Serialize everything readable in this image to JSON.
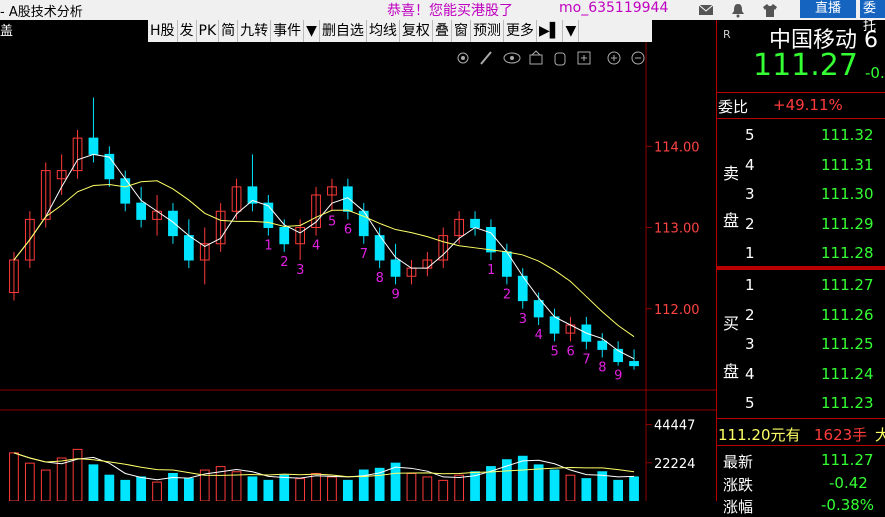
{
  "window": {
    "title": "- A股技术分析",
    "promo": "恭喜！您能买港股了",
    "user": "mo_635119944",
    "live_button": "直播",
    "cut_button": "委托"
  },
  "toolbar": [
    "H股",
    "发",
    "PK",
    "简",
    "九转",
    "事件",
    "▼",
    "删自选",
    "均线",
    "复权",
    "叠",
    "窗",
    "预测",
    "更多",
    "▶▌",
    "▼"
  ],
  "left_stub": "盖",
  "chart": {
    "price_ticks": [
      "114.00",
      "113.00",
      "112.00"
    ],
    "volume_ticks": [
      "44447",
      "22224"
    ],
    "td_labels_a": [
      "1",
      "2",
      "3",
      "4",
      "5",
      "6",
      "7",
      "8",
      "9"
    ],
    "td_labels_b": [
      "1",
      "2",
      "3",
      "4",
      "5",
      "6",
      "7",
      "8",
      "9"
    ],
    "colors": {
      "up": "#ff3b3b",
      "down": "#00e5ff",
      "ma1": "#ffffff",
      "ma2": "#ffff66",
      "td": "#e020e0",
      "grid": "#8b0000"
    }
  },
  "chart_data": {
    "type": "candlestick",
    "ylim": [
      111.0,
      115.0
    ],
    "candles": [
      [
        112.2,
        112.7,
        112.1,
        112.6
      ],
      [
        112.6,
        113.2,
        112.5,
        113.1
      ],
      [
        113.1,
        113.8,
        113.0,
        113.7
      ],
      [
        113.6,
        113.9,
        113.4,
        113.7
      ],
      [
        113.7,
        114.2,
        113.6,
        114.1
      ],
      [
        114.1,
        114.6,
        113.8,
        113.9
      ],
      [
        113.9,
        114.0,
        113.5,
        113.6
      ],
      [
        113.6,
        113.7,
        113.2,
        113.3
      ],
      [
        113.3,
        113.5,
        113.0,
        113.1
      ],
      [
        113.1,
        113.4,
        112.9,
        113.2
      ],
      [
        113.2,
        113.3,
        112.8,
        112.9
      ],
      [
        112.9,
        113.1,
        112.5,
        112.6
      ],
      [
        112.6,
        113.0,
        112.3,
        112.8
      ],
      [
        112.8,
        113.3,
        112.7,
        113.2
      ],
      [
        113.2,
        113.6,
        113.1,
        113.5
      ],
      [
        113.5,
        113.9,
        113.2,
        113.3
      ],
      [
        113.3,
        113.4,
        112.9,
        113.0
      ],
      [
        113.0,
        113.1,
        112.7,
        112.8
      ],
      [
        112.8,
        113.1,
        112.6,
        113.0
      ],
      [
        113.0,
        113.5,
        112.9,
        113.4
      ],
      [
        113.4,
        113.6,
        113.2,
        113.5
      ],
      [
        113.5,
        113.6,
        113.1,
        113.2
      ],
      [
        113.2,
        113.3,
        112.8,
        112.9
      ],
      [
        112.9,
        113.0,
        112.5,
        112.6
      ],
      [
        112.6,
        112.8,
        112.3,
        112.4
      ],
      [
        112.4,
        112.6,
        112.3,
        112.5
      ],
      [
        112.5,
        112.7,
        112.4,
        112.6
      ],
      [
        112.6,
        113.0,
        112.5,
        112.9
      ],
      [
        112.9,
        113.2,
        112.8,
        113.1
      ],
      [
        113.1,
        113.2,
        112.9,
        113.0
      ],
      [
        113.0,
        113.1,
        112.6,
        112.7
      ],
      [
        112.7,
        112.8,
        112.3,
        112.4
      ],
      [
        112.4,
        112.5,
        112.0,
        112.1
      ],
      [
        112.1,
        112.2,
        111.8,
        111.9
      ],
      [
        111.9,
        112.0,
        111.6,
        111.7
      ],
      [
        111.7,
        111.9,
        111.6,
        111.8
      ],
      [
        111.8,
        111.9,
        111.5,
        111.6
      ],
      [
        111.6,
        111.7,
        111.4,
        111.5
      ],
      [
        111.5,
        111.6,
        111.3,
        111.35
      ],
      [
        111.35,
        111.5,
        111.25,
        111.3
      ]
    ],
    "volume_ylim": [
      0,
      50000
    ],
    "volumes": [
      28000,
      22000,
      18000,
      25000,
      30000,
      21000,
      15000,
      12000,
      14000,
      11000,
      16000,
      13000,
      18000,
      20000,
      17000,
      14000,
      12000,
      15000,
      13000,
      16000,
      14000,
      12000,
      18000,
      19000,
      22000,
      16000,
      14000,
      12000,
      15000,
      17000,
      20000,
      24000,
      26000,
      21000,
      18000,
      15000,
      13000,
      17000,
      12000,
      14000
    ]
  },
  "side": {
    "stock_code_label": "R",
    "stock_name": "中国移动 6",
    "price": "111.27",
    "change": "-0.",
    "weibi_label": "委比",
    "weibi_value": "+49.11%",
    "sell_label": [
      "卖",
      "盘"
    ],
    "buy_label": [
      "买",
      "盘"
    ],
    "sell": [
      [
        "5",
        "111.32"
      ],
      [
        "4",
        "111.31"
      ],
      [
        "3",
        "111.30"
      ],
      [
        "2",
        "111.29"
      ],
      [
        "1",
        "111.28"
      ]
    ],
    "buy": [
      [
        "1",
        "111.27"
      ],
      [
        "2",
        "111.26"
      ],
      [
        "3",
        "111.25"
      ],
      [
        "4",
        "111.24"
      ],
      [
        "5",
        "111.23"
      ]
    ],
    "note_price": "111.20元有",
    "note_qty": "1623手",
    "note_more": "大",
    "latest_label": "最新",
    "latest_value": "111.27",
    "zhangdie_label": "涨跌",
    "zhangdie_value": "-0.42",
    "zhangfu_label": "涨幅",
    "zhangfu_value": "-0.38%"
  }
}
